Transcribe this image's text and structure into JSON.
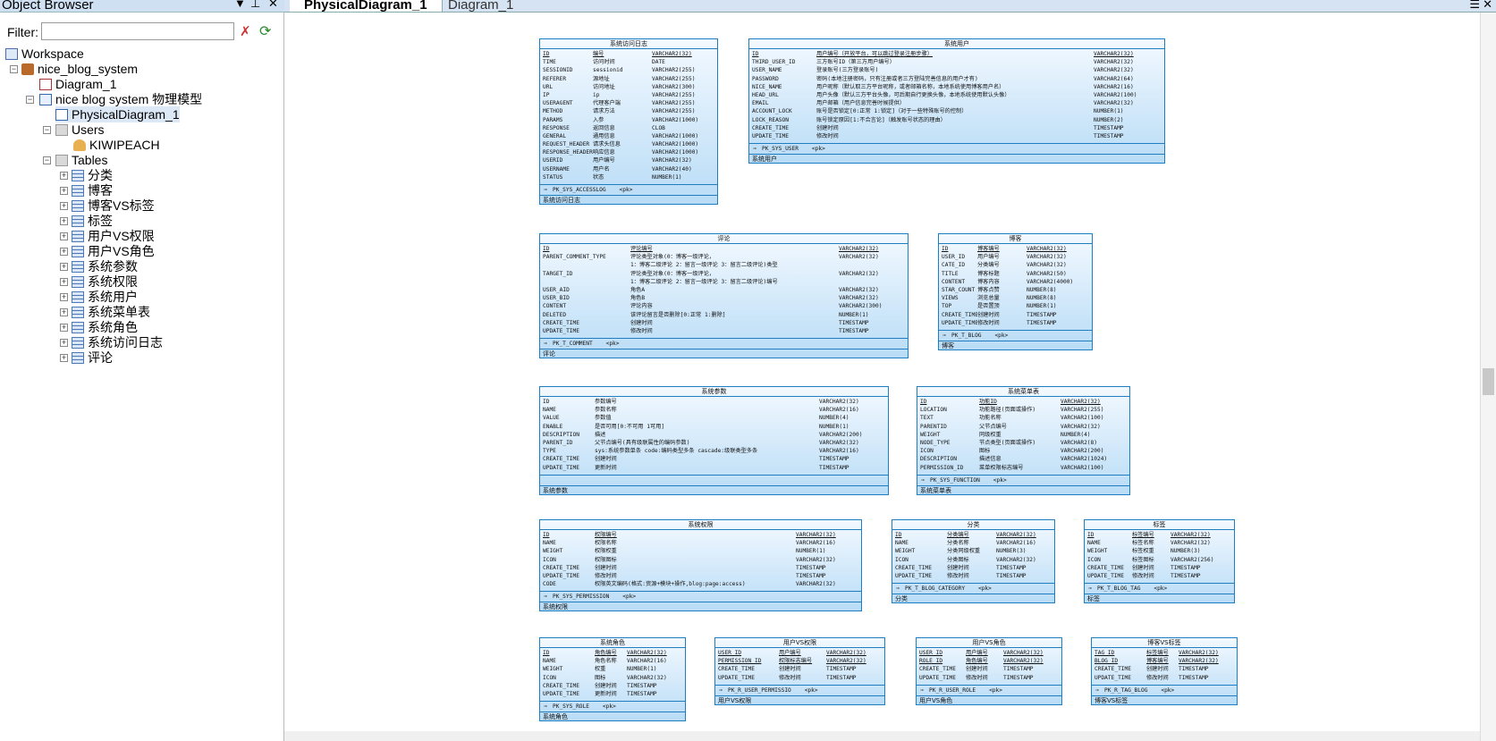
{
  "object_browser": {
    "title": "Object Browser",
    "filter_label": "Filter:",
    "filter_value": "",
    "tree": {
      "workspace": "Workspace",
      "database": "nice_blog_system",
      "diagram": "Diagram_1",
      "model": "nice blog system 物理模型",
      "physical_diagram": "PhysicalDiagram_1",
      "users_folder": "Users",
      "user": "KIWIPEACH",
      "tables_folder": "Tables",
      "tables": [
        "分类",
        "博客",
        "博客VS标签",
        "标签",
        "用户VS权限",
        "用户VS角色",
        "系统参数",
        "系统权限",
        "系统用户",
        "系统菜单表",
        "系统角色",
        "系统访问日志",
        "评论"
      ]
    }
  },
  "tabs": [
    "PhysicalDiagram_1",
    "Diagram_1"
  ],
  "entities": [
    {
      "title": "系统访问日志",
      "cols": [
        [
          "ID",
          "编号",
          "VARCHAR2(32)",
          1
        ],
        [
          "TIME",
          "访问时间",
          "DATE"
        ],
        [
          "SESSIONID",
          "sessionid",
          "VARCHAR2(255)"
        ],
        [
          "REFERER",
          "源地址",
          "VARCHAR2(255)"
        ],
        [
          "URL",
          "访问地址",
          "VARCHAR2(300)"
        ],
        [
          "IP",
          "ip",
          "VARCHAR2(255)"
        ],
        [
          "USERAGENT",
          "代理客户端",
          "VARCHAR2(255)"
        ],
        [
          "METHOD",
          "请求方法",
          "VARCHAR2(255)"
        ],
        [
          "PARAMS",
          "入参",
          "VARCHAR2(1000)"
        ],
        [
          "RESPONSE",
          "返回信息",
          "CLOB"
        ],
        [
          "GENERAL",
          "通用信息",
          "VARCHAR2(1000)"
        ],
        [
          "REQUEST_HEADER",
          "请求头信息",
          "VARCHAR2(1000)"
        ],
        [
          "RESPONSE_HEADER",
          "响应信息",
          "VARCHAR2(1000)"
        ],
        [
          "USERID",
          "用户编号",
          "VARCHAR2(32)"
        ],
        [
          "USERNAME",
          "用户名",
          "VARCHAR2(40)"
        ],
        [
          "STATUS",
          "状态",
          "NUMBER(1)"
        ]
      ],
      "key": "PK_SYS_ACCESSLOG",
      "keytag": "<pk>",
      "footer": "系统访问日志"
    },
    {
      "title": "系统用户",
      "cols": [
        [
          "ID",
          "用户编号（开放平台，可以跳过登录注册步骤）",
          "VARCHAR2(32)",
          1
        ],
        [
          "THIRD_USER_ID",
          "三方账号ID（第三方用户编号）",
          "VARCHAR2(32)"
        ],
        [
          "USER_NAME",
          "登录账号(三方登录账号)",
          "VARCHAR2(32)"
        ],
        [
          "PASSWORD",
          "密码(本地注册密码，只有注册或者三方登陆完善信息的用户才有)",
          "VARCHAR2(64)"
        ],
        [
          "NICE_NAME",
          "用户昵称（默认取三方平台昵称，或者邮箱名称，本地系统使用博客用户名）",
          "VARCHAR2(16)"
        ],
        [
          "HEAD_URL",
          "用户头像（默认三方平台头像，可后期自行更换头像，本地系统使用默认头像）",
          "VARCHAR2(100)"
        ],
        [
          "EMAIL",
          "用户邮箱（用户信息完善时候提供）",
          "VARCHAR2(32)"
        ],
        [
          "ACCOUNT_LOCK",
          "账号是否锁定[0:正常 1:锁定]（对于一些特殊账号的控制）",
          "NUMBER(1)"
        ],
        [
          "LOCK_REASON",
          "账号锁定原因[1:不合言论]（触发账号状态的理由）",
          "NUMBER(2)"
        ],
        [
          "CREATE_TIME",
          "创建时间",
          "TIMESTAMP"
        ],
        [
          "UPDATE_TIME",
          "修改时间",
          "TIMESTAMP"
        ]
      ],
      "key": "PK_SYS_USER",
      "keytag": "<pk>",
      "footer": "系统用户"
    },
    {
      "title": "评论",
      "cols": [
        [
          "ID",
          "评论编号",
          "VARCHAR2(32)",
          1
        ],
        [
          "PARENT_COMMENT_TYPE",
          "评论类型对象(0：博客一级评论，",
          "VARCHAR2(32)"
        ],
        [
          "",
          "1：博客二级评论 2：留言一级评论 3：留言二级评论)类型",
          ""
        ],
        [
          "TARGET_ID",
          "评论类型对象(0：博客一级评论，",
          "VARCHAR2(32)"
        ],
        [
          "",
          "1：博客二级评论 2：留言一级评论 3：留言二级评论)编号",
          ""
        ],
        [
          "USER_AID",
          "角色A",
          "VARCHAR2(32)"
        ],
        [
          "USER_BID",
          "角色B",
          "VARCHAR2(32)"
        ],
        [
          "CONTENT",
          "评论内容",
          "VARCHAR2(300)"
        ],
        [
          "DELETED",
          "该评论留言是否删除[0:正常 1:删除]",
          "NUMBER(1)"
        ],
        [
          "CREATE_TIME",
          "创建时间",
          "TIMESTAMP"
        ],
        [
          "UPDATE_TIME",
          "修改时间",
          "TIMESTAMP"
        ]
      ],
      "key": "PK_T_COMMENT",
      "keytag": "<pk>",
      "footer": "评论"
    },
    {
      "title": "博客",
      "cols": [
        [
          "ID",
          "博客编号",
          "VARCHAR2(32)",
          1
        ],
        [
          "USER_ID",
          "用户编号",
          "VARCHAR2(32)"
        ],
        [
          "CATE_ID",
          "分类编号",
          "VARCHAR2(32)"
        ],
        [
          "TITLE",
          "博客标题",
          "VARCHAR2(50)"
        ],
        [
          "CONTENT",
          "博客内容",
          "VARCHAR2(4000)"
        ],
        [
          "STAR_COUNT",
          "博客点赞",
          "NUMBER(8)"
        ],
        [
          "VIEWS",
          "浏览总量",
          "NUMBER(8)"
        ],
        [
          "TOP",
          "是否置顶",
          "NUMBER(1)"
        ],
        [
          "CREATE_TIME",
          "创建时间",
          "TIMESTAMP"
        ],
        [
          "UPDATE_TIME",
          "修改时间",
          "TIMESTAMP"
        ]
      ],
      "key": "PK_T_BLOG",
      "keytag": "<pk>",
      "footer": "博客"
    },
    {
      "title": "系统参数",
      "cols": [
        [
          "ID",
          "参数编号",
          "VARCHAR2(32)"
        ],
        [
          "NAME",
          "参数名称",
          "VARCHAR2(16)"
        ],
        [
          "VALUE",
          "参数值",
          "NUMBER(4)"
        ],
        [
          "ENABLE",
          "是否可用[0:不可用 1可用]",
          "NUMBER(1)"
        ],
        [
          "DESCRIPTION",
          "描述",
          "VARCHAR2(200)"
        ],
        [
          "PARENT_ID",
          "父节点编号(具有级联属性的编码参数)",
          "VARCHAR2(32)"
        ],
        [
          "TYPE",
          "sys:系统参数单条 code:编码类型多条 cascade:级联类型多条",
          "VARCHAR2(16)"
        ],
        [
          "CREATE_TIME",
          "创建时间",
          "TIMESTAMP"
        ],
        [
          "UPDATE_TIME",
          "更新时间",
          "TIMESTAMP"
        ]
      ],
      "key": "",
      "keytag": "",
      "footer": "系统参数"
    },
    {
      "title": "系统菜单表",
      "cols": [
        [
          "ID",
          "功能ID",
          "VARCHAR2(32)",
          1
        ],
        [
          "LOCATION",
          "功能路径(页面或操作)",
          "VARCHAR2(255)"
        ],
        [
          "TEXT",
          "功能名称",
          "VARCHAR2(100)"
        ],
        [
          "PARENTID",
          "父节点编号",
          "VARCHAR2(32)"
        ],
        [
          "WEIGHT",
          "同级权重",
          "NUMBER(4)"
        ],
        [
          "NODE_TYPE",
          "节点类型(页面或操作)",
          "VARCHAR2(8)"
        ],
        [
          "ICON",
          "图标",
          "VARCHAR2(200)"
        ],
        [
          "DESCRIPTION",
          "描述信息",
          "VARCHAR2(1024)"
        ],
        [
          "PERMISSION_ID",
          "菜单权限标志编号",
          "VARCHAR2(100)"
        ]
      ],
      "key": "PK_SYS_FUNCTION",
      "keytag": "<pk>",
      "footer": "系统菜单表"
    },
    {
      "title": "系统权限",
      "cols": [
        [
          "ID",
          "权限编号",
          "VARCHAR2(32)",
          1
        ],
        [
          "NAME",
          "权限名称",
          "VARCHAR2(16)"
        ],
        [
          "WEIGHT",
          "权限权重",
          "NUMBER(1)"
        ],
        [
          "ICON",
          "权限图标",
          "VARCHAR2(32)"
        ],
        [
          "CREATE_TIME",
          "创建时间",
          "TIMESTAMP"
        ],
        [
          "UPDATE_TIME",
          "修改时间",
          "TIMESTAMP"
        ],
        [
          "CODE",
          "权限英文编码(格式:资源+模块+操作,blog:page:access)",
          "VARCHAR2(32)"
        ]
      ],
      "key": "PK_SYS_PERMISSION",
      "keytag": "<pk>",
      "footer": "系统权限"
    },
    {
      "title": "分类",
      "cols": [
        [
          "ID",
          "分类编号",
          "VARCHAR2(32)",
          1
        ],
        [
          "NAME",
          "分类名称",
          "VARCHAR2(16)"
        ],
        [
          "WEIGHT",
          "分类同级权重",
          "NUMBER(3)"
        ],
        [
          "ICON",
          "分类图标",
          "VARCHAR2(32)"
        ],
        [
          "CREATE_TIME",
          "创建时间",
          "TIMESTAMP"
        ],
        [
          "UPDATE_TIME",
          "修改时间",
          "TIMESTAMP"
        ]
      ],
      "key": "PK_T_BLOG_CATEGORY",
      "keytag": "<pk>",
      "footer": "分类"
    },
    {
      "title": "标签",
      "cols": [
        [
          "ID",
          "标签编号",
          "VARCHAR2(32)",
          1
        ],
        [
          "NAME",
          "标签名称",
          "VARCHAR2(32)"
        ],
        [
          "WEIGHT",
          "标签权重",
          "NUMBER(3)"
        ],
        [
          "ICON",
          "标签图标",
          "VARCHAR2(256)"
        ],
        [
          "CREATE_TIME",
          "创建时间",
          "TIMESTAMP"
        ],
        [
          "UPDATE_TIME",
          "修改时间",
          "TIMESTAMP"
        ]
      ],
      "key": "PK_T_BLOG_TAG",
      "keytag": "<pk>",
      "footer": "标签"
    },
    {
      "title": "系统角色",
      "cols": [
        [
          "ID",
          "角色编号",
          "VARCHAR2(32)",
          1
        ],
        [
          "NAME",
          "角色名称",
          "VARCHAR2(16)"
        ],
        [
          "WEIGHT",
          "权重",
          "NUMBER(1)"
        ],
        [
          "ICON",
          "图标",
          "VARCHAR2(32)"
        ],
        [
          "CREATE_TIME",
          "创建时间",
          "TIMESTAMP"
        ],
        [
          "UPDATE_TIME",
          "更新时间",
          "TIMESTAMP"
        ]
      ],
      "key": "PK_SYS_ROLE",
      "keytag": "<pk>",
      "footer": "系统角色"
    },
    {
      "title": "用户VS权限",
      "cols": [
        [
          "USER_ID",
          "用户编号",
          "VARCHAR2(32)",
          1
        ],
        [
          "PERMISSION_ID",
          "权限标志编号",
          "VARCHAR2(32)",
          1
        ],
        [
          "CREATE_TIME",
          "创建时间",
          "TIMESTAMP"
        ],
        [
          "UPDATE_TIME",
          "修改时间",
          "TIMESTAMP"
        ]
      ],
      "key": "PK_R_USER_PERMISSIO",
      "keytag": "<pk>",
      "footer": "用户VS权限"
    },
    {
      "title": "用户VS角色",
      "cols": [
        [
          "USER_ID",
          "用户编号",
          "VARCHAR2(32)",
          1
        ],
        [
          "ROLE_ID",
          "角色编号",
          "VARCHAR2(32)",
          1
        ],
        [
          "CREATE_TIME",
          "创建时间",
          "TIMESTAMP"
        ],
        [
          "UPDATE_TIME",
          "修改时间",
          "TIMESTAMP"
        ]
      ],
      "key": "PK_R_USER_ROLE",
      "keytag": "<pk>",
      "footer": "用户VS角色"
    },
    {
      "title": "博客VS标签",
      "cols": [
        [
          "TAG_ID",
          "标签编号",
          "VARCHAR2(32)",
          1
        ],
        [
          "BLOG_ID",
          "博客编号",
          "VARCHAR2(32)",
          1
        ],
        [
          "CREATE_TIME",
          "创建时间",
          "TIMESTAMP"
        ],
        [
          "UPDATE_TIME",
          "修改时间",
          "TIMESTAMP"
        ]
      ],
      "key": "PK_R_TAG_BLOG",
      "keytag": "<pk>",
      "footer": "博客VS标签"
    }
  ]
}
